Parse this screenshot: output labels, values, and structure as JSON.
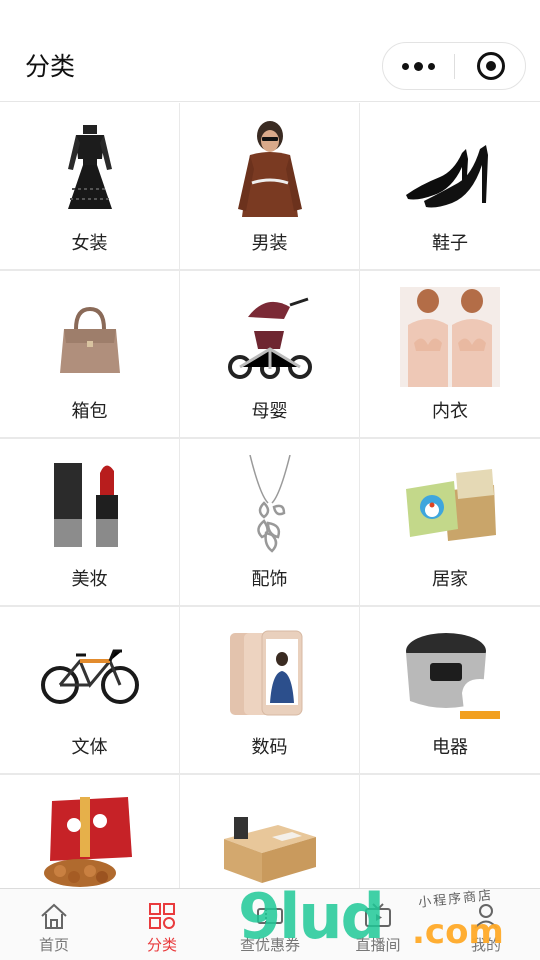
{
  "nav": {
    "title": "分类"
  },
  "categories": [
    {
      "label": "女装",
      "icon": "dress-image"
    },
    {
      "label": "男装",
      "icon": "man-sweater-image"
    },
    {
      "label": "鞋子",
      "icon": "high-heels-image"
    },
    {
      "label": "箱包",
      "icon": "handbag-image"
    },
    {
      "label": "母婴",
      "icon": "baby-tricycle-image"
    },
    {
      "label": "内衣",
      "icon": "lingerie-image"
    },
    {
      "label": "美妆",
      "icon": "lipstick-image"
    },
    {
      "label": "配饰",
      "icon": "necklace-image"
    },
    {
      "label": "居家",
      "icon": "cushions-image"
    },
    {
      "label": "文体",
      "icon": "bicycle-image"
    },
    {
      "label": "数码",
      "icon": "phone-image"
    },
    {
      "label": "电器",
      "icon": "rice-cooker-image"
    },
    {
      "label": "",
      "icon": "snack-gift-box-image"
    },
    {
      "label": "",
      "icon": "wooden-tissue-box-image"
    },
    {
      "label": "",
      "icon": ""
    }
  ],
  "tabbar": {
    "items": [
      {
        "label": "首页",
        "icon": "home-icon",
        "active": false
      },
      {
        "label": "分类",
        "icon": "category-icon",
        "active": true
      },
      {
        "label": "查优惠券",
        "icon": "coupon-icon",
        "active": false
      },
      {
        "label": "直播间",
        "icon": "tv-icon",
        "active": false
      },
      {
        "label": "我的",
        "icon": "user-icon",
        "active": false
      }
    ]
  },
  "watermark": {
    "main": "9lud",
    "suffix": ".com",
    "small": "小程序商店"
  },
  "colors": {
    "accent": "#e93b3d",
    "tab_inactive": "#777777",
    "divider": "#e9e9e9"
  }
}
